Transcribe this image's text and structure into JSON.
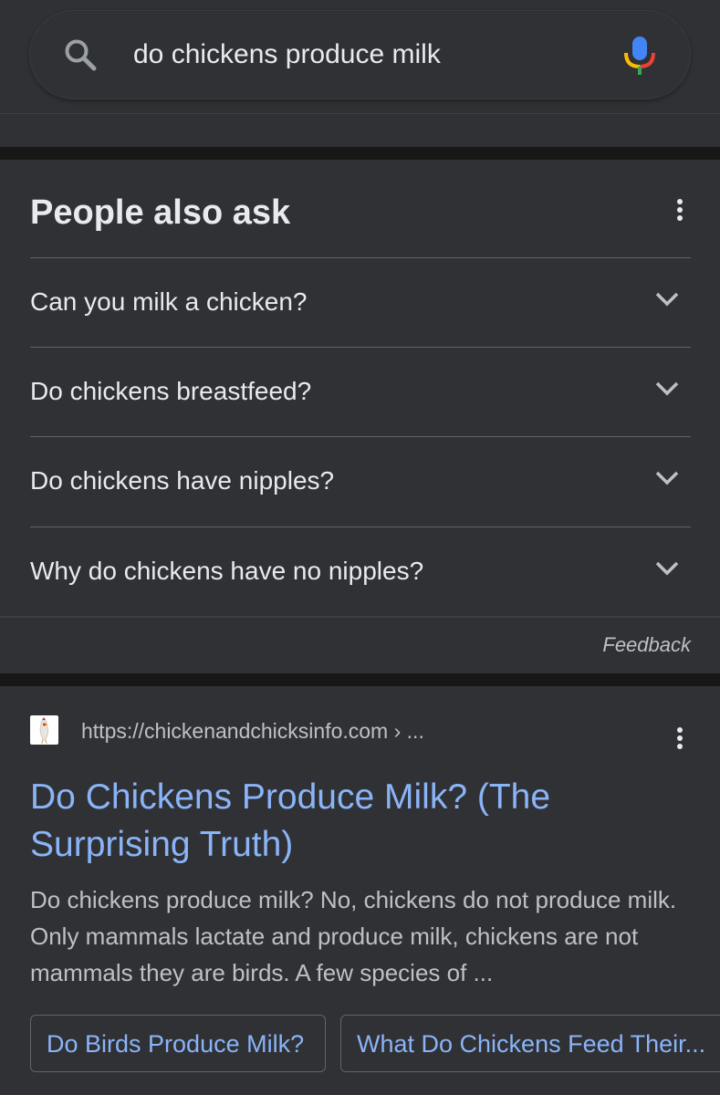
{
  "search": {
    "query": "do chickens produce milk"
  },
  "icons": {
    "search": "search-icon",
    "mic": "microphone-icon",
    "more": "more-vert-icon",
    "expand": "chevron-down-icon",
    "favicon": "site-favicon-chicken"
  },
  "people_also_ask": {
    "title": "People also ask",
    "questions": [
      "Can you milk a chicken?",
      "Do chickens breastfeed?",
      "Do chickens have nipples?",
      "Why do chickens have no nipples?"
    ],
    "feedback": "Feedback"
  },
  "result": {
    "url": "https://chickenandchicksinfo.com › ...",
    "title": "Do Chickens Produce Milk? (The Surprising Truth)",
    "snippet": "Do chickens produce milk? No, chickens do not produce milk. Only mammals lactate and produce milk, chickens are not mammals they are birds. A few species of ...",
    "sitelinks": [
      "Do Birds Produce Milk?",
      "What Do Chickens Feed Their..."
    ]
  },
  "colors": {
    "background": "#202124",
    "card": "#303134",
    "link": "#8ab4f8",
    "text": "#e8eaed",
    "muted_text": "#bdc1c6",
    "divider": "#5f6368",
    "mic_blue": "#4285f4",
    "mic_red": "#ea4335",
    "mic_yellow": "#fbbc04",
    "mic_green": "#34a853"
  }
}
